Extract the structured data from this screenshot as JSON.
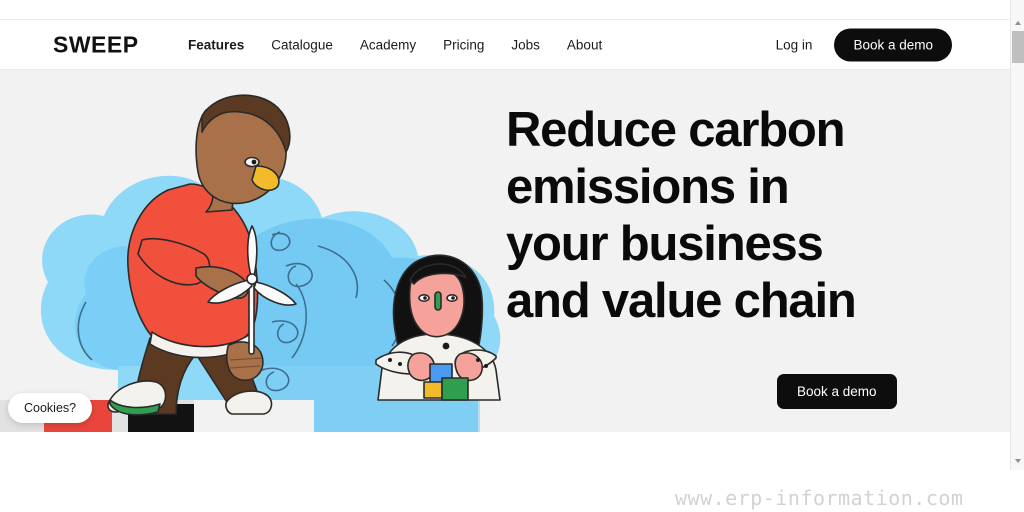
{
  "brand": {
    "name": "SWEEP"
  },
  "nav": {
    "items": [
      {
        "label": "Features",
        "active": true
      },
      {
        "label": "Catalogue",
        "active": false
      },
      {
        "label": "Academy",
        "active": false
      },
      {
        "label": "Pricing",
        "active": false
      },
      {
        "label": "Jobs",
        "active": false
      },
      {
        "label": "About",
        "active": false
      }
    ]
  },
  "header_actions": {
    "login_label": "Log in",
    "demo_label": "Book a demo"
  },
  "hero": {
    "headline_lines": [
      "Reduce carbon",
      "emissions in",
      "your business",
      "and value chain"
    ],
    "cta_label": "Book a demo",
    "background_color": "#f2f2f2"
  },
  "cookies": {
    "label": "Cookies?"
  },
  "watermark": {
    "text": "www.erp-information.com"
  },
  "colors": {
    "accent_dark": "#0d0d0d",
    "page_bg": "#ffffff",
    "hero_bg": "#f2f2f2",
    "blob_light": "#8ed8f8",
    "blob_mid": "#6cc6f2",
    "sweater_red": "#f1503c",
    "trousers_brown": "#5c3a21",
    "skin_brown": "#a9714a",
    "hair_brown": "#5a3a22",
    "beak_yellow": "#f2bb2b",
    "shoe_green": "#2f9e4f",
    "hair_black": "#111111",
    "skin_pink": "#f5a39a",
    "platform_red": "#e8463c"
  },
  "illustration": {
    "alt": "Person in red sweater blowing on a small wind turbine and a seated person holding colourful blocks"
  },
  "scrollbar": {
    "up_icon": "triangle-up-icon",
    "down_icon": "triangle-down-icon",
    "thumb": "scrollbar-thumb"
  }
}
